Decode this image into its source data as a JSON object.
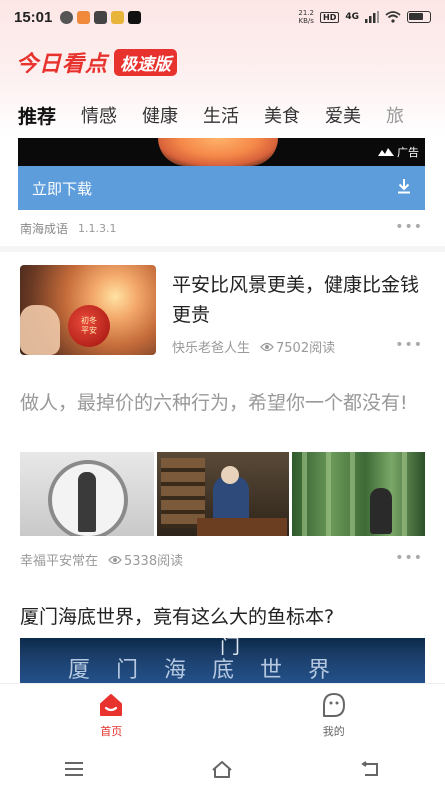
{
  "status_bar": {
    "time": "15:01",
    "net_speed_value": "21.2",
    "net_speed_unit": "KB/s",
    "signal_tag": "4G"
  },
  "app": {
    "logo_main": "今日看点",
    "logo_badge": "极速版"
  },
  "tabs": [
    {
      "label": "推荐",
      "active": true
    },
    {
      "label": "情感"
    },
    {
      "label": "健康"
    },
    {
      "label": "生活"
    },
    {
      "label": "美食"
    },
    {
      "label": "爱美"
    },
    {
      "label": "旅"
    }
  ],
  "ad": {
    "tag": "广告",
    "button_label": "立即下载",
    "advertiser": "南海成语",
    "version": "1.1.3.1"
  },
  "articles": [
    {
      "title": "平安比风景更美，健康比金钱更贵",
      "thumb_text_1": "初冬",
      "thumb_text_2": "平安",
      "author": "快乐老爸人生",
      "reads": "7502阅读"
    },
    {
      "title": "做人，最掉价的六种行为，希望你一个都没有!",
      "author": "幸福平安常在",
      "reads": "5338阅读"
    },
    {
      "title": "厦门海底世界，竟有这么大的鱼标本?",
      "image_text": "厦门海底世界",
      "image_top_text": "门"
    }
  ],
  "bottom_nav": {
    "home_label": "首页",
    "mine_label": "我的"
  },
  "colors": {
    "brand": "#e8322e",
    "ad_button": "#5d9ddb"
  }
}
